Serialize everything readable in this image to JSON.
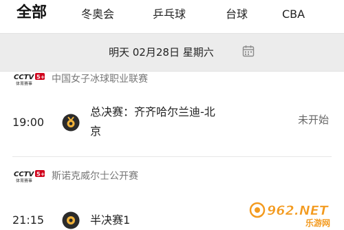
{
  "tabs": [
    {
      "label": "全部",
      "active": true
    },
    {
      "label": "冬奥会"
    },
    {
      "label": "乒乓球"
    },
    {
      "label": "台球"
    },
    {
      "label": "CBA"
    }
  ],
  "date_bar": {
    "label": "明天 02月28日 星期六",
    "icon": "calendar-icon"
  },
  "leagues": [
    {
      "name": "中国女子冰球职业联赛",
      "logo_text": "CCTV5+",
      "logo_sub": "体育赛事",
      "match": {
        "time": "19:00",
        "title": "总决赛：齐齐哈尔兰迪-北京",
        "status": "未开始"
      }
    },
    {
      "name": "斯诺克威尔士公开赛",
      "logo_text": "CCTV5+",
      "logo_sub": "体育赛事",
      "match": {
        "time": "21:15",
        "title": "半决赛1",
        "status": ""
      }
    }
  ],
  "watermark": {
    "text": "962.NET",
    "sub": "乐游网"
  },
  "colors": {
    "date_bar_bg": "#ececec",
    "cctv_red": "#d0021b",
    "watermark_orange": "#f39a1e"
  }
}
